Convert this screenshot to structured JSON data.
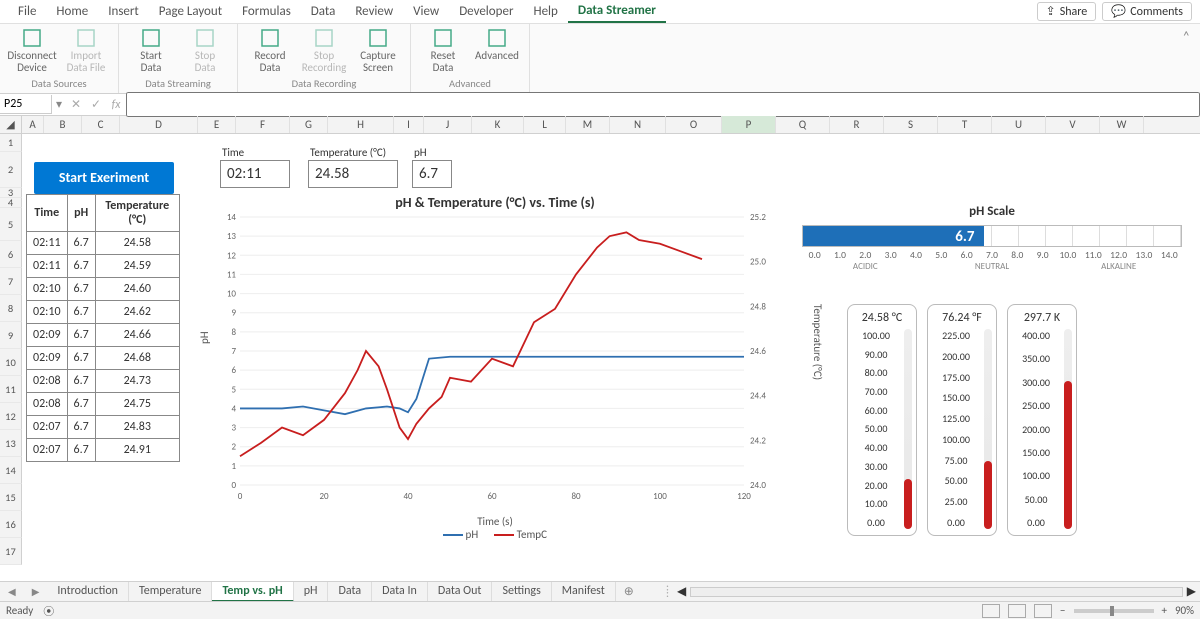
{
  "menu": {
    "items": [
      "File",
      "Home",
      "Insert",
      "Page Layout",
      "Formulas",
      "Data",
      "Review",
      "View",
      "Developer",
      "Help",
      "Data Streamer"
    ],
    "active": 10,
    "share": "Share",
    "comments": "Comments"
  },
  "ribbon": {
    "groups": [
      {
        "label": "Data Sources",
        "items": [
          {
            "name": "disconnect-device",
            "l1": "Disconnect",
            "l2": "Device",
            "disabled": false
          },
          {
            "name": "import-data-file",
            "l1": "Import",
            "l2": "Data File",
            "disabled": true
          }
        ]
      },
      {
        "label": "Data Streaming",
        "items": [
          {
            "name": "start-data",
            "l1": "Start",
            "l2": "Data",
            "disabled": false
          },
          {
            "name": "stop-data",
            "l1": "Stop",
            "l2": "Data",
            "disabled": true
          }
        ]
      },
      {
        "label": "Data Recording",
        "items": [
          {
            "name": "record-data",
            "l1": "Record",
            "l2": "Data",
            "disabled": false
          },
          {
            "name": "stop-recording",
            "l1": "Stop",
            "l2": "Recording",
            "disabled": true
          },
          {
            "name": "capture-screen",
            "l1": "Capture",
            "l2": "Screen",
            "disabled": false
          }
        ]
      },
      {
        "label": "Advanced",
        "items": [
          {
            "name": "reset-data",
            "l1": "Reset",
            "l2": "Data",
            "disabled": false
          },
          {
            "name": "advanced",
            "l1": "Advanced",
            "l2": "",
            "disabled": false
          }
        ]
      }
    ]
  },
  "namebox": "P25",
  "columns": [
    "A",
    "B",
    "C",
    "D",
    "E",
    "F",
    "G",
    "H",
    "I",
    "J",
    "K",
    "L",
    "M",
    "N",
    "O",
    "P",
    "Q",
    "R",
    "S",
    "T",
    "U",
    "V",
    "W"
  ],
  "selected_col": "P",
  "rows": [
    "1",
    "2",
    "3",
    "4",
    "5",
    "6",
    "7",
    "8",
    "9",
    "10",
    "11",
    "12",
    "13",
    "14",
    "15",
    "16",
    "17"
  ],
  "start_button": "Start Exeriment",
  "readouts": {
    "time_label": "Time",
    "time_val": "02:11",
    "temp_label": "Temperature (°C)",
    "temp_val": "24.58",
    "ph_label": "pH",
    "ph_val": "6.7"
  },
  "table": {
    "headers": [
      "Time",
      "pH",
      "Temperature (°C)"
    ],
    "rows": [
      [
        "02:11",
        "6.7",
        "24.58"
      ],
      [
        "02:11",
        "6.7",
        "24.59"
      ],
      [
        "02:10",
        "6.7",
        "24.60"
      ],
      [
        "02:10",
        "6.7",
        "24.62"
      ],
      [
        "02:09",
        "6.7",
        "24.66"
      ],
      [
        "02:09",
        "6.7",
        "24.68"
      ],
      [
        "02:08",
        "6.7",
        "24.73"
      ],
      [
        "02:08",
        "6.7",
        "24.75"
      ],
      [
        "02:07",
        "6.7",
        "24.83"
      ],
      [
        "02:07",
        "6.7",
        "24.91"
      ]
    ]
  },
  "chart_data": {
    "type": "line",
    "title": "pH & Temperature (°C) vs. Time (s)",
    "xlabel": "Time (s)",
    "y_left_label": "pH",
    "y_right_label": "Temperature (°C)",
    "x_ticks": [
      0,
      20,
      40,
      60,
      80,
      100,
      120
    ],
    "y_left_ticks": [
      0,
      1,
      2,
      3,
      4,
      5,
      6,
      7,
      8,
      9,
      10,
      11,
      12,
      13,
      14
    ],
    "y_right_ticks": [
      24.0,
      24.2,
      24.4,
      24.6,
      24.8,
      25.0,
      25.2
    ],
    "xlim": [
      0,
      120
    ],
    "y_left_lim": [
      0,
      14
    ],
    "y_right_lim": [
      24.0,
      25.2
    ],
    "series": [
      {
        "name": "pH",
        "color": "#2f6fb0",
        "x": [
          0,
          5,
          10,
          15,
          20,
          25,
          30,
          35,
          38,
          40,
          42,
          45,
          50,
          60,
          70,
          80,
          90,
          100,
          110,
          120
        ],
        "y": [
          4.0,
          4.0,
          4.0,
          4.1,
          3.9,
          3.7,
          4.0,
          4.1,
          4.0,
          3.8,
          4.5,
          6.6,
          6.7,
          6.7,
          6.7,
          6.7,
          6.7,
          6.7,
          6.7,
          6.7
        ]
      },
      {
        "name": "TempC",
        "color": "#c81e1e",
        "x": [
          0,
          5,
          10,
          15,
          20,
          25,
          28,
          30,
          33,
          35,
          38,
          40,
          42,
          45,
          48,
          50,
          55,
          60,
          65,
          70,
          75,
          80,
          85,
          88,
          92,
          95,
          100,
          105,
          110
        ],
        "y": [
          1.5,
          2.2,
          3.0,
          2.6,
          3.4,
          4.8,
          6.0,
          7.0,
          6.2,
          5.0,
          3.0,
          2.4,
          3.2,
          4.0,
          4.6,
          5.6,
          5.4,
          6.6,
          6.2,
          8.5,
          9.2,
          11.0,
          12.4,
          13.0,
          13.2,
          12.8,
          12.6,
          12.2,
          11.8
        ]
      }
    ],
    "legend": [
      "pH",
      "TempC"
    ]
  },
  "ph_scale": {
    "title": "pH Scale",
    "value": "6.7",
    "fill_pct": 48,
    "ticks": [
      "0.0",
      "1.0",
      "2.0",
      "3.0",
      "4.0",
      "5.0",
      "6.0",
      "7.0",
      "8.0",
      "9.0",
      "10.0",
      "11.0",
      "12.0",
      "13.0",
      "14.0"
    ],
    "zones": [
      "ACIDIC",
      "NEUTRAL",
      "ALKALINE"
    ]
  },
  "thermometers": [
    {
      "title": "24.58 °C",
      "labels": [
        "100.00",
        "90.00",
        "80.00",
        "70.00",
        "60.00",
        "50.00",
        "40.00",
        "30.00",
        "20.00",
        "10.00",
        "0.00"
      ],
      "fill_pct": 25,
      "color": "#c81e1e"
    },
    {
      "title": "76.24 °F",
      "labels": [
        "225.00",
        "200.00",
        "175.00",
        "150.00",
        "125.00",
        "100.00",
        "75.00",
        "50.00",
        "25.00",
        "0.00"
      ],
      "fill_pct": 34,
      "color": "#c81e1e"
    },
    {
      "title": "297.7 K",
      "labels": [
        "400.00",
        "350.00",
        "300.00",
        "250.00",
        "200.00",
        "150.00",
        "100.00",
        "50.00",
        "0.00"
      ],
      "fill_pct": 74,
      "color": "#c81e1e"
    }
  ],
  "sheet_tabs": {
    "tabs": [
      "Introduction",
      "Temperature",
      "Temp vs. pH",
      "pH",
      "Data",
      "Data In",
      "Data Out",
      "Settings",
      "Manifest"
    ],
    "active": 2
  },
  "status": {
    "ready": "Ready",
    "zoom": "90%"
  }
}
